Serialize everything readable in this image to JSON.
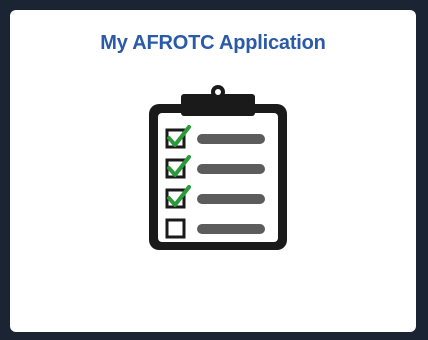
{
  "tile": {
    "title": "My AFROTC Application",
    "icon": "clipboard-checklist-icon",
    "checklist": [
      {
        "checked": true
      },
      {
        "checked": true
      },
      {
        "checked": true
      },
      {
        "checked": false
      }
    ]
  },
  "colors": {
    "background": "#1b2433",
    "tile": "#ffffff",
    "title": "#2a5aa8",
    "icon_dark": "#1a1a1a",
    "line": "#5c5c5c",
    "check": "#2a9a3a"
  }
}
